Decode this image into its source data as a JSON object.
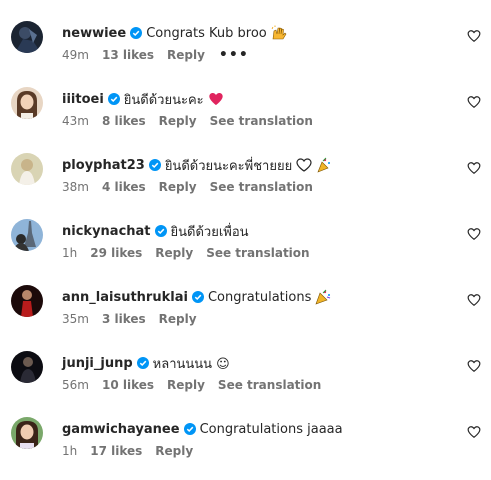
{
  "comments": [
    {
      "username": "newwiee",
      "text": "Congrats Kub broo",
      "emoji": "raised-hands-emoji",
      "time": "49m",
      "likes": "13 likes",
      "reply": "Reply",
      "more": "•••"
    },
    {
      "username": "iiitoei",
      "text": "ยินดีด้วยนะคะ",
      "emoji": "red-heart-emoji",
      "time": "43m",
      "likes": "8 likes",
      "reply": "Reply",
      "translate": "See translation"
    },
    {
      "username": "ployphat23",
      "text": "ยินดีด้วยนะคะพี่ชายยย",
      "emoji": "white-heart-party-emoji",
      "time": "38m",
      "likes": "4 likes",
      "reply": "Reply",
      "translate": "See translation"
    },
    {
      "username": "nickynachat",
      "text": "ยินดีด้วยเพื่อน",
      "time": "1h",
      "likes": "29 likes",
      "reply": "Reply",
      "translate": "See translation"
    },
    {
      "username": "ann_laisuthruklai",
      "text": "Congratulations",
      "emoji": "party-popper-emoji",
      "time": "35m",
      "likes": "3 likes",
      "reply": "Reply"
    },
    {
      "username": "junji_junp",
      "text": "หลานนนน ☺",
      "time": "56m",
      "likes": "10 likes",
      "reply": "Reply",
      "translate": "See translation"
    },
    {
      "username": "gamwichayanee",
      "text": "Congratulations jaaaa",
      "time": "1h",
      "likes": "17 likes",
      "reply": "Reply"
    }
  ],
  "colors": {
    "verified_badge": "#0095f6",
    "meta_text": "#737373",
    "username": "#262626",
    "red_heart": "#e0245e"
  },
  "icons": {
    "like": "heart-outline-icon",
    "verified": "verified-badge-icon"
  }
}
